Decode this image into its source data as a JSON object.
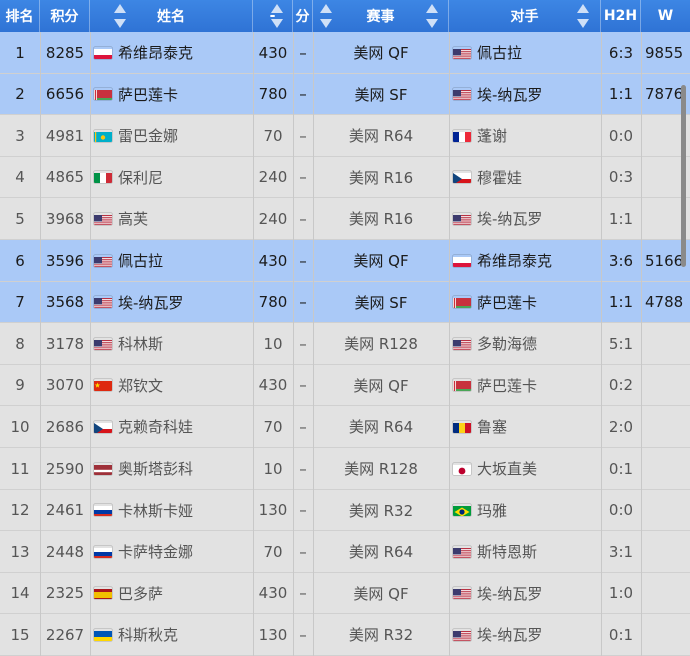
{
  "headers": {
    "rank": "排名",
    "points": "积分",
    "name": "姓名",
    "defend": "-",
    "score": "分",
    "event": "赛事",
    "opponent": "对手",
    "h2h": "H2H",
    "w": "W"
  },
  "rows": [
    {
      "rank": "1",
      "points": "8285",
      "flag": "PL",
      "name": "希维昂泰克",
      "defend": "430",
      "dash": "–",
      "event": "美网 QF",
      "opp_flag": "US",
      "opponent": "佩古拉",
      "h2h": "6:3",
      "w": "9855",
      "highlight": true
    },
    {
      "rank": "2",
      "points": "6656",
      "flag": "BY",
      "name": "萨巴莲卡",
      "defend": "780",
      "dash": "–",
      "event": "美网 SF",
      "opp_flag": "US",
      "opponent": "埃-纳瓦罗",
      "h2h": "1:1",
      "w": "7876",
      "highlight": true
    },
    {
      "rank": "3",
      "points": "4981",
      "flag": "KZ",
      "name": "雷巴金娜",
      "defend": "70",
      "dash": "–",
      "event": "美网 R64",
      "opp_flag": "FR",
      "opponent": "蓬谢",
      "h2h": "0:0",
      "w": "",
      "highlight": false
    },
    {
      "rank": "4",
      "points": "4865",
      "flag": "IT",
      "name": "保利尼",
      "defend": "240",
      "dash": "–",
      "event": "美网 R16",
      "opp_flag": "CZ",
      "opponent": "穆霍娃",
      "h2h": "0:3",
      "w": "",
      "highlight": false
    },
    {
      "rank": "5",
      "points": "3968",
      "flag": "US",
      "name": "高芙",
      "defend": "240",
      "dash": "–",
      "event": "美网 R16",
      "opp_flag": "US",
      "opponent": "埃-纳瓦罗",
      "h2h": "1:1",
      "w": "",
      "highlight": false
    },
    {
      "rank": "6",
      "points": "3596",
      "flag": "US",
      "name": "佩古拉",
      "defend": "430",
      "dash": "–",
      "event": "美网 QF",
      "opp_flag": "PL",
      "opponent": "希维昂泰克",
      "h2h": "3:6",
      "w": "5166",
      "highlight": true
    },
    {
      "rank": "7",
      "points": "3568",
      "flag": "US",
      "name": "埃-纳瓦罗",
      "defend": "780",
      "dash": "–",
      "event": "美网 SF",
      "opp_flag": "BY",
      "opponent": "萨巴莲卡",
      "h2h": "1:1",
      "w": "4788",
      "highlight": true
    },
    {
      "rank": "8",
      "points": "3178",
      "flag": "US",
      "name": "科林斯",
      "defend": "10",
      "dash": "–",
      "event": "美网 R128",
      "opp_flag": "US",
      "opponent": "多勒海德",
      "h2h": "5:1",
      "w": "",
      "highlight": false
    },
    {
      "rank": "9",
      "points": "3070",
      "flag": "CN",
      "name": "郑钦文",
      "defend": "430",
      "dash": "–",
      "event": "美网 QF",
      "opp_flag": "BY",
      "opponent": "萨巴莲卡",
      "h2h": "0:2",
      "w": "",
      "highlight": false
    },
    {
      "rank": "10",
      "points": "2686",
      "flag": "CZ",
      "name": "克赖奇科娃",
      "defend": "70",
      "dash": "–",
      "event": "美网 R64",
      "opp_flag": "RO",
      "opponent": "鲁塞",
      "h2h": "2:0",
      "w": "",
      "highlight": false
    },
    {
      "rank": "11",
      "points": "2590",
      "flag": "LV",
      "name": "奥斯塔彭科",
      "defend": "10",
      "dash": "–",
      "event": "美网 R128",
      "opp_flag": "JP",
      "opponent": "大坂直美",
      "h2h": "0:1",
      "w": "",
      "highlight": false
    },
    {
      "rank": "12",
      "points": "2461",
      "flag": "RU",
      "name": "卡林斯卡娅",
      "defend": "130",
      "dash": "–",
      "event": "美网 R32",
      "opp_flag": "BR",
      "opponent": "玛雅",
      "h2h": "0:0",
      "w": "",
      "highlight": false
    },
    {
      "rank": "13",
      "points": "2448",
      "flag": "RU",
      "name": "卡萨特金娜",
      "defend": "70",
      "dash": "–",
      "event": "美网 R64",
      "opp_flag": "US",
      "opponent": "斯特恩斯",
      "h2h": "3:1",
      "w": "",
      "highlight": false
    },
    {
      "rank": "14",
      "points": "2325",
      "flag": "ES",
      "name": "巴多萨",
      "defend": "430",
      "dash": "–",
      "event": "美网 QF",
      "opp_flag": "US",
      "opponent": "埃-纳瓦罗",
      "h2h": "1:0",
      "w": "",
      "highlight": false
    },
    {
      "rank": "15",
      "points": "2267",
      "flag": "UA",
      "name": "科斯秋克",
      "defend": "130",
      "dash": "–",
      "event": "美网 R32",
      "opp_flag": "US",
      "opponent": "埃-纳瓦罗",
      "h2h": "0:1",
      "w": "",
      "highlight": false
    }
  ],
  "colors": {
    "header": "#3479dc",
    "highlight_row": "#aac9f7",
    "normal_row": "#e2e2e2"
  }
}
